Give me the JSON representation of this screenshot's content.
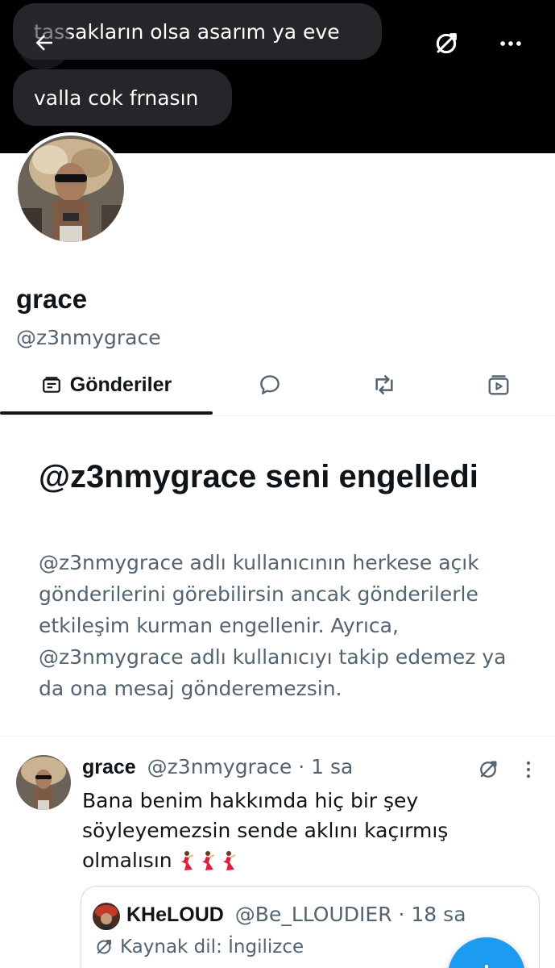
{
  "banner": {
    "message_1": "tassakların olsa asarım ya eve",
    "message_2": "valla cok frnasın"
  },
  "icons": {
    "back": "arrow-left-icon",
    "translate": "translate-icon",
    "more": "more-horizontal-icon"
  },
  "profile": {
    "name": "grace",
    "handle": "@z3nmygrace"
  },
  "tabs": {
    "posts_label": "Gönderiler"
  },
  "blocked": {
    "title": "@z3nmygrace seni engelledi",
    "description": "@z3nmygrace adlı kullanıcının herkese açık gönderilerini görebilirsin ancak gönderilerle etkileşim kurman engellenir. Ayrıca, @z3nmygrace adlı kullanıcıyı takip edemez ya da ona mesaj gönderemezsin."
  },
  "post": {
    "name": "grace",
    "handle": "@z3nmygrace",
    "separator": " · ",
    "time": "1 sa",
    "text": "Bana benim hakkımda hiç bir şey söyleyemezsin sende aklını kaçırmış olmalısın",
    "emoji": "💃💃💃"
  },
  "quote": {
    "name": "KHeLOUD",
    "handle": "@Be_LLOUDIER",
    "separator": " · ",
    "time": "18 sa",
    "source_label": "Kaynak dil: İngilizce"
  },
  "colors": {
    "accent": "#1d9bf0",
    "text": "#0f1419",
    "muted": "#536471",
    "bubble": "#26262a"
  }
}
